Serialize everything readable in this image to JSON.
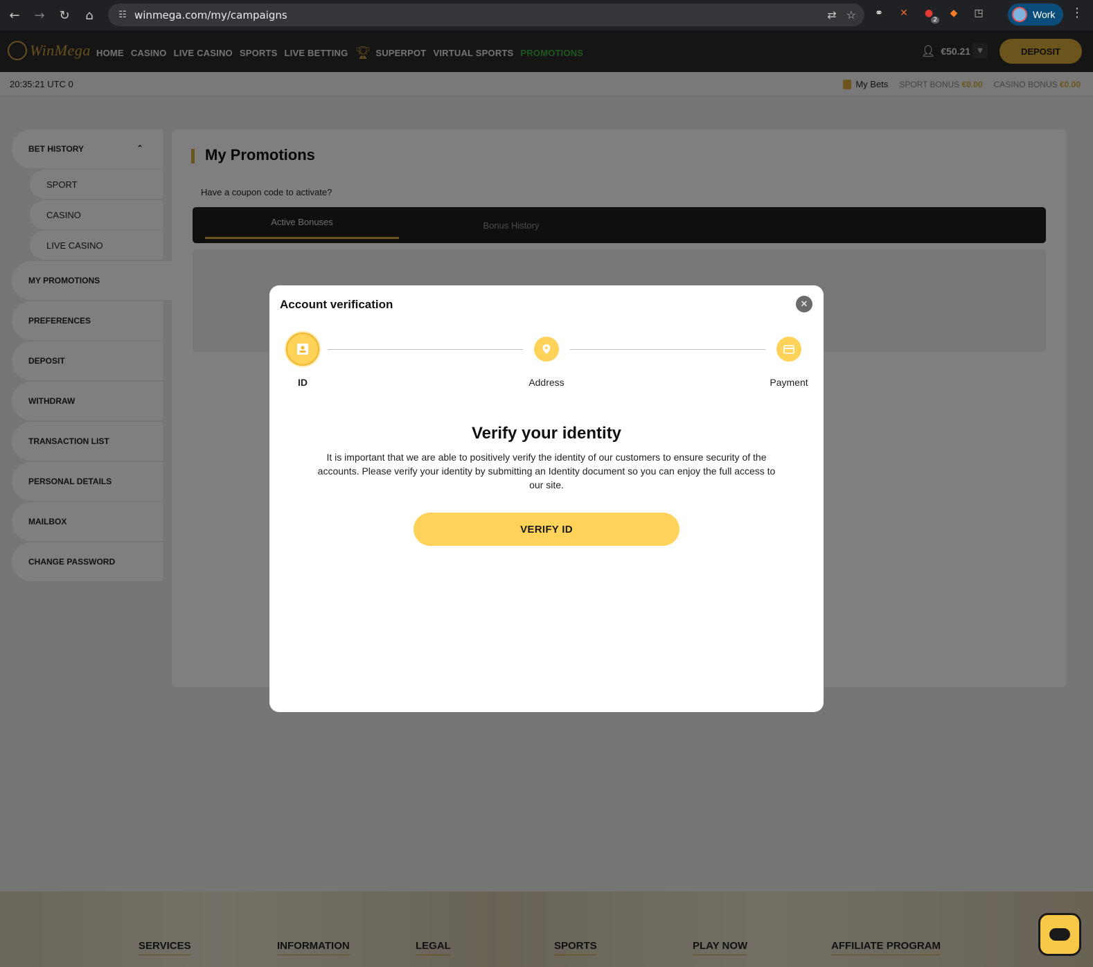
{
  "browser": {
    "url": "winmega.com/my/campaigns",
    "profile_label": "Work",
    "extension_badge": "2"
  },
  "header": {
    "logo_text": "WinMega",
    "nav": [
      "HOME",
      "CASINO",
      "LIVE CASINO",
      "SPORTS",
      "LIVE BETTING",
      "SUPERPOT",
      "VIRTUAL SPORTS",
      "PROMOTIONS"
    ],
    "active_nav": "PROMOTIONS",
    "balance": "€50.21",
    "deposit_label": "DEPOSIT"
  },
  "subbar": {
    "clock": "20:35:21 UTC 0",
    "my_bets": "My Bets",
    "sport_bonus_label": "SPORT BONUS",
    "sport_bonus_value": "€0.00",
    "casino_bonus_label": "CASINO BONUS",
    "casino_bonus_value": "€0.00"
  },
  "sidebar": {
    "bet_history": "BET HISTORY",
    "sub_items": [
      "SPORT",
      "CASINO",
      "LIVE CASINO"
    ],
    "items": [
      "MY PROMOTIONS",
      "PREFERENCES",
      "DEPOSIT",
      "WITHDRAW",
      "TRANSACTION LIST",
      "PERSONAL DETAILS",
      "MAILBOX",
      "CHANGE PASSWORD"
    ]
  },
  "main": {
    "title": "My Promotions",
    "coupon_link": "Have a coupon code to activate?",
    "tabs": [
      "Active Bonuses",
      "Bonus History"
    ]
  },
  "modal": {
    "title": "Account verification",
    "steps": [
      "ID",
      "Address",
      "Payment"
    ],
    "heading": "Verify your identity",
    "text": "It is important that we are able to positively verify the identity of our customers to ensure security of the accounts. Please verify your identity by submitting an Identity document so you can enjoy the full access to our site.",
    "button": "VERIFY ID"
  },
  "footer": {
    "columns": [
      "SERVICES",
      "INFORMATION",
      "LEGAL",
      "SPORTS",
      "PLAY NOW",
      "AFFILIATE PROGRAM"
    ]
  },
  "colors": {
    "accent": "#d8a93a",
    "modal_yellow": "#ffd35a",
    "promo_green": "#3fae3f"
  }
}
